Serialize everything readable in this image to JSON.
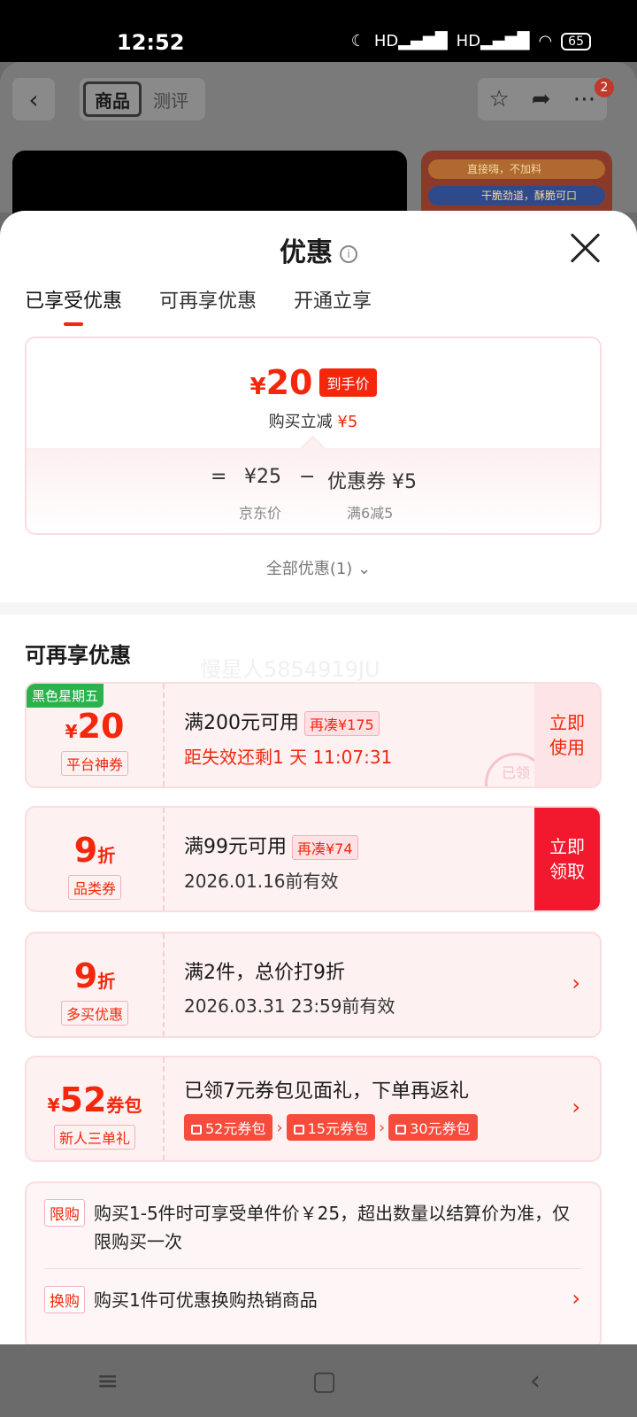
{
  "status_bar": {
    "time": "12:52",
    "battery": "65",
    "net1": "HD",
    "net2": "HD"
  },
  "background_page": {
    "tab_active": "商品",
    "tab_inactive": "测评",
    "badge_count": "2",
    "thumb_line1": "直接嗨，不加料",
    "thumb_line2": "干脆劲道，酥脆可口"
  },
  "sheet": {
    "title": "优惠",
    "tabs": [
      "已享受优惠",
      "可再享优惠",
      "开通立享"
    ],
    "final_price": "20",
    "final_price_currency": "¥",
    "final_price_tag": "到手价",
    "reduce_label": "购买立减",
    "reduce_value": "¥5",
    "formula": {
      "eq": "=",
      "jd_price": "¥25",
      "minus": "−",
      "coupon_label": "优惠券 ¥5",
      "jd_price_label": "京东价",
      "coupon_desc": "满6减5"
    },
    "all_discounts": "全部优惠(1)",
    "section_title": "可再享优惠",
    "watermark": "慢星人5854919JU",
    "coupons": [
      {
        "badge": "黑色星期五",
        "amount_prefix": "¥",
        "amount": "20",
        "type": "平台神券",
        "condition": "满200元可用",
        "pill": "再凑¥175",
        "expire": "距失效还剩1 天 11:07:31",
        "action": "立即\n使用",
        "stamp": "已领"
      },
      {
        "amount": "9",
        "amount_suffix": "折",
        "type": "品类券",
        "condition": "满99元可用",
        "pill": "再凑¥74",
        "expire": "2026.01.16前有效",
        "action": "立即\n领取"
      },
      {
        "amount": "9",
        "amount_suffix": "折",
        "type": "多买优惠",
        "condition": "满2件，总价打9折",
        "expire": "2026.03.31 23:59前有效"
      },
      {
        "amount_prefix": "¥",
        "amount": "52",
        "amount_suffix": "券包",
        "type": "新人三单礼",
        "condition": "已领7元券包见面礼，下单再返礼",
        "packs": [
          "52元券包",
          "15元券包",
          "30元券包"
        ]
      }
    ],
    "limits": [
      {
        "tag": "限购",
        "text": "购买1-5件时可享受单件价￥25，超出数量以结算价为准，仅限购买一次"
      },
      {
        "tag": "换购",
        "text": "购买1件可优惠换购热销商品"
      }
    ]
  }
}
